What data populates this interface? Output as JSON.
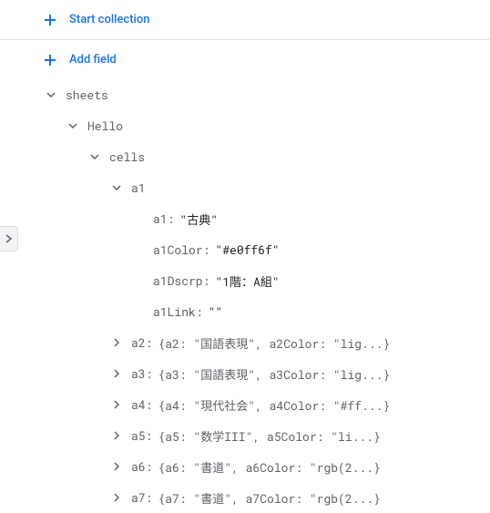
{
  "actions": {
    "start_collection": "Start collection",
    "add_field": "Add field"
  },
  "tree": {
    "root_key": "sheets",
    "child1_key": "Hello",
    "child2_key": "cells",
    "child3_key": "a1",
    "a1_fields": {
      "a1_key": "a1",
      "a1_val": "\"古典\"",
      "a1Color_key": "a1Color",
      "a1Color_val": "\"#e0ff6f\"",
      "a1Dscrp_key": "a1Dscrp",
      "a1Dscrp_val": "\"1階：A組\"",
      "a1Link_key": "a1Link",
      "a1Link_val": "\"\""
    },
    "collapsed": [
      {
        "key": "a2",
        "preview": "{a2: \"国語表現\", a2Color: \"lig...}"
      },
      {
        "key": "a3",
        "preview": "{a3: \"国語表現\", a3Color: \"lig...}"
      },
      {
        "key": "a4",
        "preview": "{a4: \"現代社会\", a4Color: \"#ff...}"
      },
      {
        "key": "a5",
        "preview": "{a5: \"数学III\", a5Color: \"li...}"
      },
      {
        "key": "a6",
        "preview": "{a6: \"書道\", a6Color: \"rgb(2...}"
      },
      {
        "key": "a7",
        "preview": "{a7: \"書道\", a7Color: \"rgb(2...}"
      }
    ]
  }
}
